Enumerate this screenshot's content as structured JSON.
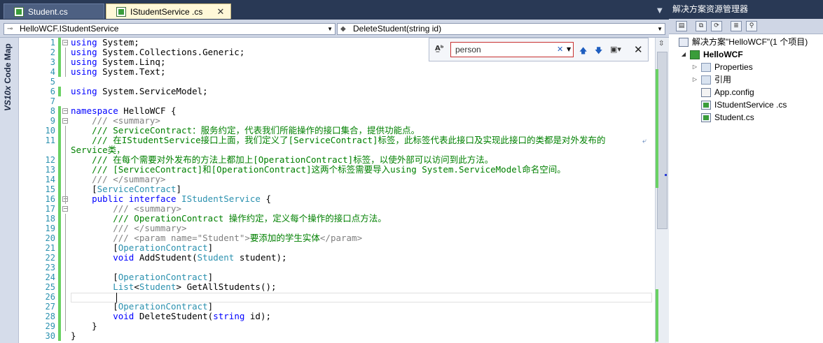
{
  "tabs": [
    {
      "label": "Student.cs",
      "active": false
    },
    {
      "label": "IStudentService .cs",
      "active": true
    }
  ],
  "navbar": {
    "type_combo": "HelloWCF.IStudentService",
    "member_combo": "DeleteStudent(string id)"
  },
  "codemap": {
    "label_prefix": "VS10x",
    "label_main": " Code Map"
  },
  "find": {
    "query": "person",
    "options_icon": "find-options-icon",
    "prev_icon": "arrow-up-icon",
    "next_icon": "arrow-down-icon",
    "close_icon": "close-icon"
  },
  "code": {
    "line_numbers": [
      "1",
      "2",
      "3",
      "4",
      "5",
      "6",
      "7",
      "8",
      "9",
      "10",
      "11",
      "",
      "12",
      "13",
      "14",
      "15",
      "16",
      "17",
      "18",
      "19",
      "20",
      "21",
      "22",
      "23",
      "24",
      "25",
      "26",
      "27",
      "28",
      "29",
      "30"
    ],
    "lines": [
      [
        [
          "kw",
          "using"
        ],
        [
          "",
          "System;"
        ]
      ],
      [
        [
          "kw",
          "using"
        ],
        [
          "",
          "System.Collections.Generic;"
        ]
      ],
      [
        [
          "kw",
          "using"
        ],
        [
          "",
          "System.Linq;"
        ]
      ],
      [
        [
          "kw",
          "using"
        ],
        [
          "",
          "System.Text;"
        ]
      ],
      [],
      [
        [
          "kw",
          "using"
        ],
        [
          "",
          "System.ServiceModel;"
        ]
      ],
      [],
      [
        [
          "kw",
          "namespace"
        ],
        [
          "",
          "HelloWCF {"
        ]
      ],
      [
        [
          "gr",
          "    /// <summary>"
        ]
      ],
      [
        [
          "cm",
          "    /// ServiceContract：服务约定，代表我们所能操作的接口集合，提供功能点。"
        ]
      ],
      [
        [
          "cm",
          "    /// 在IStudentService接口上面，我们定义了[ServiceContract]标签，此标签代表此接口及实现此接口的类都是对外发布的"
        ]
      ],
      [
        [
          "cm",
          "Service类，"
        ]
      ],
      [
        [
          "cm",
          "    /// 在每个需要对外发布的方法上都加上[OperationContract]标签，以使外部可以访问到此方法。"
        ]
      ],
      [
        [
          "cm",
          "    /// [ServiceContract]和[OperationContract]这两个标签需要导入using System.ServiceModel命名空间。"
        ]
      ],
      [
        [
          "gr",
          "    /// </summary>"
        ]
      ],
      [
        [
          "",
          "    ["
        ],
        [
          "ty",
          "ServiceContract"
        ],
        [
          "",
          "]"
        ]
      ],
      [
        [
          "",
          "    "
        ],
        [
          "kw",
          "public interface"
        ],
        [
          "",
          ""
        ],
        [
          "ty",
          " IStudentService"
        ],
        [
          "",
          " {"
        ]
      ],
      [
        [
          "gr",
          "        /// <summary>"
        ]
      ],
      [
        [
          "cm",
          "        /// OperationContract 操作约定，定义每个操作的接口点方法。"
        ]
      ],
      [
        [
          "gr",
          "        /// </summary>"
        ]
      ],
      [
        [
          "gr",
          "        /// <param name=\"Student\">"
        ],
        [
          "cm",
          "要添加的学生实体"
        ],
        [
          "gr",
          "</param>"
        ]
      ],
      [
        [
          "",
          "        ["
        ],
        [
          "ty",
          "OperationContract"
        ],
        [
          "",
          "]"
        ]
      ],
      [
        [
          "",
          "        "
        ],
        [
          "kw",
          "void"
        ],
        [
          "",
          " AddStudent("
        ],
        [
          "ty",
          "Student"
        ],
        [
          "",
          " student);"
        ]
      ],
      [],
      [
        [
          "",
          "        ["
        ],
        [
          "ty",
          "OperationContract"
        ],
        [
          "",
          "]"
        ]
      ],
      [
        [
          "",
          "        "
        ],
        [
          "ty",
          "List"
        ],
        [
          "",
          "<"
        ],
        [
          "ty",
          "Student"
        ],
        [
          "",
          "> GetAllStudents();"
        ]
      ],
      [],
      [
        [
          "",
          "        ["
        ],
        [
          "ty",
          "OperationContract"
        ],
        [
          "",
          "]"
        ]
      ],
      [
        [
          "",
          "        "
        ],
        [
          "kw",
          "void"
        ],
        [
          "",
          " DeleteStudent("
        ],
        [
          "kw",
          "string"
        ],
        [
          "",
          " id);"
        ]
      ],
      [
        [
          "",
          "    }"
        ]
      ],
      [
        [
          "",
          "}"
        ]
      ]
    ]
  },
  "solution_explorer": {
    "title": "解决方案资源管理器",
    "solution_label": "解决方案\"HelloWCF\"(1 个项目)",
    "project_label": "HelloWCF",
    "items": [
      {
        "label": "Properties",
        "icon": "folder-icon",
        "expandable": true
      },
      {
        "label": "引用",
        "icon": "references-icon",
        "expandable": true
      },
      {
        "label": "App.config",
        "icon": "config-file-icon",
        "expandable": false
      },
      {
        "label": "IStudentService .cs",
        "icon": "cs-file-icon",
        "expandable": false
      },
      {
        "label": "Student.cs",
        "icon": "cs-file-icon",
        "expandable": false
      }
    ]
  },
  "colors": {
    "chrome": "#293955",
    "keyword": "#0000ff",
    "type": "#2b91af",
    "comment": "#008000",
    "doc_tag": "#808080",
    "changed_line": "#6ad163",
    "find_border": "#c83030"
  }
}
